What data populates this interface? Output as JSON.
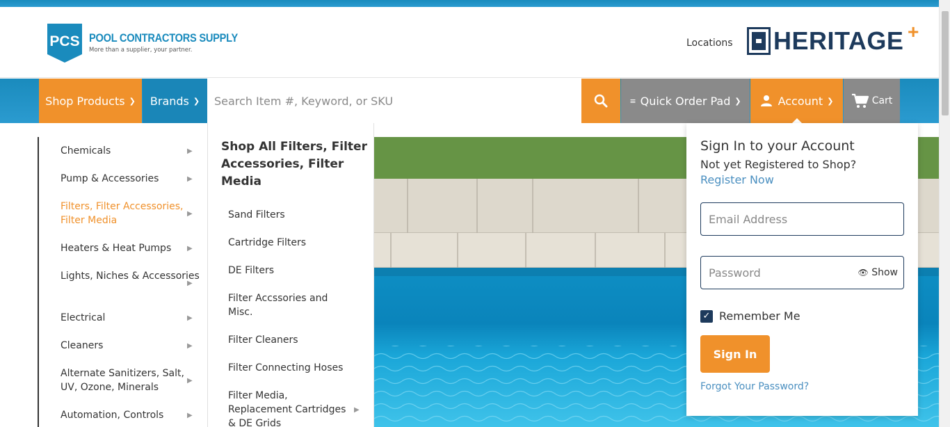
{
  "brand": {
    "logo_abbrev": "PCS",
    "logo_name": "POOL CONTRACTORS SUPPLY",
    "tagline": "More than a supplier, your partner."
  },
  "header": {
    "locations": "Locations",
    "partner_logo": "HERITAGE"
  },
  "nav": {
    "shop_products": "Shop Products",
    "brands": "Brands",
    "search_placeholder": "Search Item #, Keyword, or SKU",
    "quick_order": "Quick Order Pad",
    "account": "Account",
    "cart": "Cart"
  },
  "categories": [
    {
      "label": "Chemicals",
      "active": false
    },
    {
      "label": "Pump & Accessories",
      "active": false
    },
    {
      "label": "Filters, Filter Accessories, Filter Media",
      "active": true
    },
    {
      "label": "Heaters & Heat Pumps",
      "active": false
    },
    {
      "label": "Lights, Niches & Accessories",
      "active": false
    },
    {
      "label": "Electrical",
      "active": false
    },
    {
      "label": "Cleaners",
      "active": false
    },
    {
      "label": "Alternate Sanitizers, Salt, UV, Ozone, Minerals",
      "active": false
    },
    {
      "label": "Automation, Controls",
      "active": false
    }
  ],
  "submenu": {
    "title": "Shop All Filters, Filter Accessories, Filter Media",
    "items": [
      {
        "label": "Sand Filters",
        "has_children": false
      },
      {
        "label": "Cartridge Filters",
        "has_children": false
      },
      {
        "label": "DE Filters",
        "has_children": false
      },
      {
        "label": "Filter Accssories and Misc.",
        "has_children": false
      },
      {
        "label": "Filter Cleaners",
        "has_children": false
      },
      {
        "label": "Filter Connecting Hoses",
        "has_children": false
      },
      {
        "label": "Filter Media, Replacement Cartridges & DE Grids",
        "has_children": true
      }
    ]
  },
  "signin": {
    "title": "Sign In to your Account",
    "not_registered": "Not yet Registered to Shop?",
    "register_link": "Register Now",
    "email_placeholder": "Email Address",
    "password_placeholder": "Password",
    "show_label": "Show",
    "remember_label": "Remember Me",
    "remember_checked": true,
    "submit_label": "Sign In",
    "forgot_link": "Forgot Your Password?"
  },
  "colors": {
    "brand_blue": "#1a8bbd",
    "accent_orange": "#f0912b",
    "nav_gray": "#8a8a8a",
    "navy": "#1d3a5c",
    "link_blue": "#4a8fc0"
  },
  "icons": {
    "search": "search-icon",
    "chevron": "chevron-down-icon",
    "user": "user-icon",
    "cart": "cart-icon",
    "eye": "eye-icon",
    "check": "checkmark-icon",
    "arrow": "triangle-right-icon",
    "quick_order": "list-icon"
  }
}
